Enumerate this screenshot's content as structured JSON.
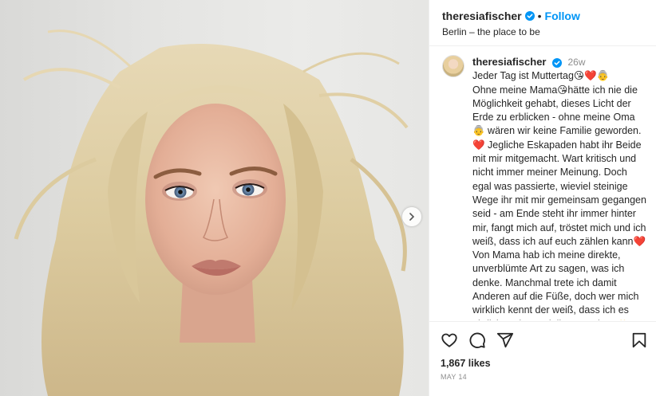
{
  "header": {
    "username": "theresiafischer",
    "separator": "•",
    "follow_label": "Follow",
    "location": "Berlin – the place to be"
  },
  "caption": {
    "username": "theresiafischer",
    "time": "26w",
    "text": "Jeder Tag ist Muttertag😘❤️👵\nOhne meine Mama😘hätte ich nie die Möglichkeit gehabt, dieses Licht der Erde zu erblicken - ohne meine Oma 👵 wären wir keine Familie geworden. ❤️ Jegliche Eskapaden habt ihr Beide mit mir mitgemacht. Wart kritisch und nicht immer meiner Meinung. Doch egal was passierte, wieviel steinige Wege ihr mit mir gemeinsam gegangen seid - am Ende steht ihr immer hinter mir, fangt mich auf, tröstet mich und ich weiß, dass ich auf euch zählen kann❤️ Von Mama hab ich meine direkte, unverblümte Art zu sagen, was ich denke. Manchmal trete ich damit Anderen auf die Füße, doch wer mich wirklich kennt der weiß, dass ich es ehrlich und gut mit ihnen meine. 🫶"
  },
  "engagement": {
    "likes": "1,867 likes",
    "date": "MAY 14"
  },
  "icons": {
    "verified": "verified-badge-icon",
    "next": "chevron-right-icon",
    "like": "heart-icon",
    "comment": "comment-icon",
    "share": "paper-plane-icon",
    "save": "bookmark-icon"
  },
  "colors": {
    "accent": "#0095f6",
    "text": "#262626",
    "muted": "#8e8e8e",
    "divider": "#efefef"
  }
}
